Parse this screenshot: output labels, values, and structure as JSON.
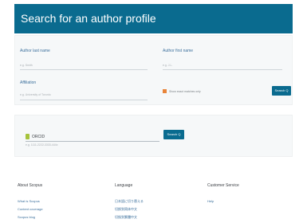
{
  "header": {
    "title": "Search for an author profile"
  },
  "form": {
    "last_name": {
      "label": "Author last name",
      "placeholder": "e.g. Smith"
    },
    "first_name": {
      "label": "Author first name",
      "placeholder": "e.g. J.L."
    },
    "affiliation": {
      "label": "Affiliation",
      "placeholder": "e.g. University of Toronto"
    },
    "exact_match_label": "Show exact matches only",
    "search_label": "Search Q"
  },
  "orcid": {
    "label": "ORCID",
    "placeholder": "e.g. 1111-2222-3333-444x",
    "search_label": "Search Q"
  },
  "footer": {
    "columns": [
      {
        "title": "About Scopus",
        "links": [
          "What is Scopus",
          "Content coverage",
          "Scopus blog"
        ]
      },
      {
        "title": "Language",
        "links": [
          "日本語に切り替える",
          "切换到简体中文",
          "切換到繁體中文"
        ]
      },
      {
        "title": "Customer Service",
        "links": [
          "Help"
        ]
      }
    ]
  }
}
